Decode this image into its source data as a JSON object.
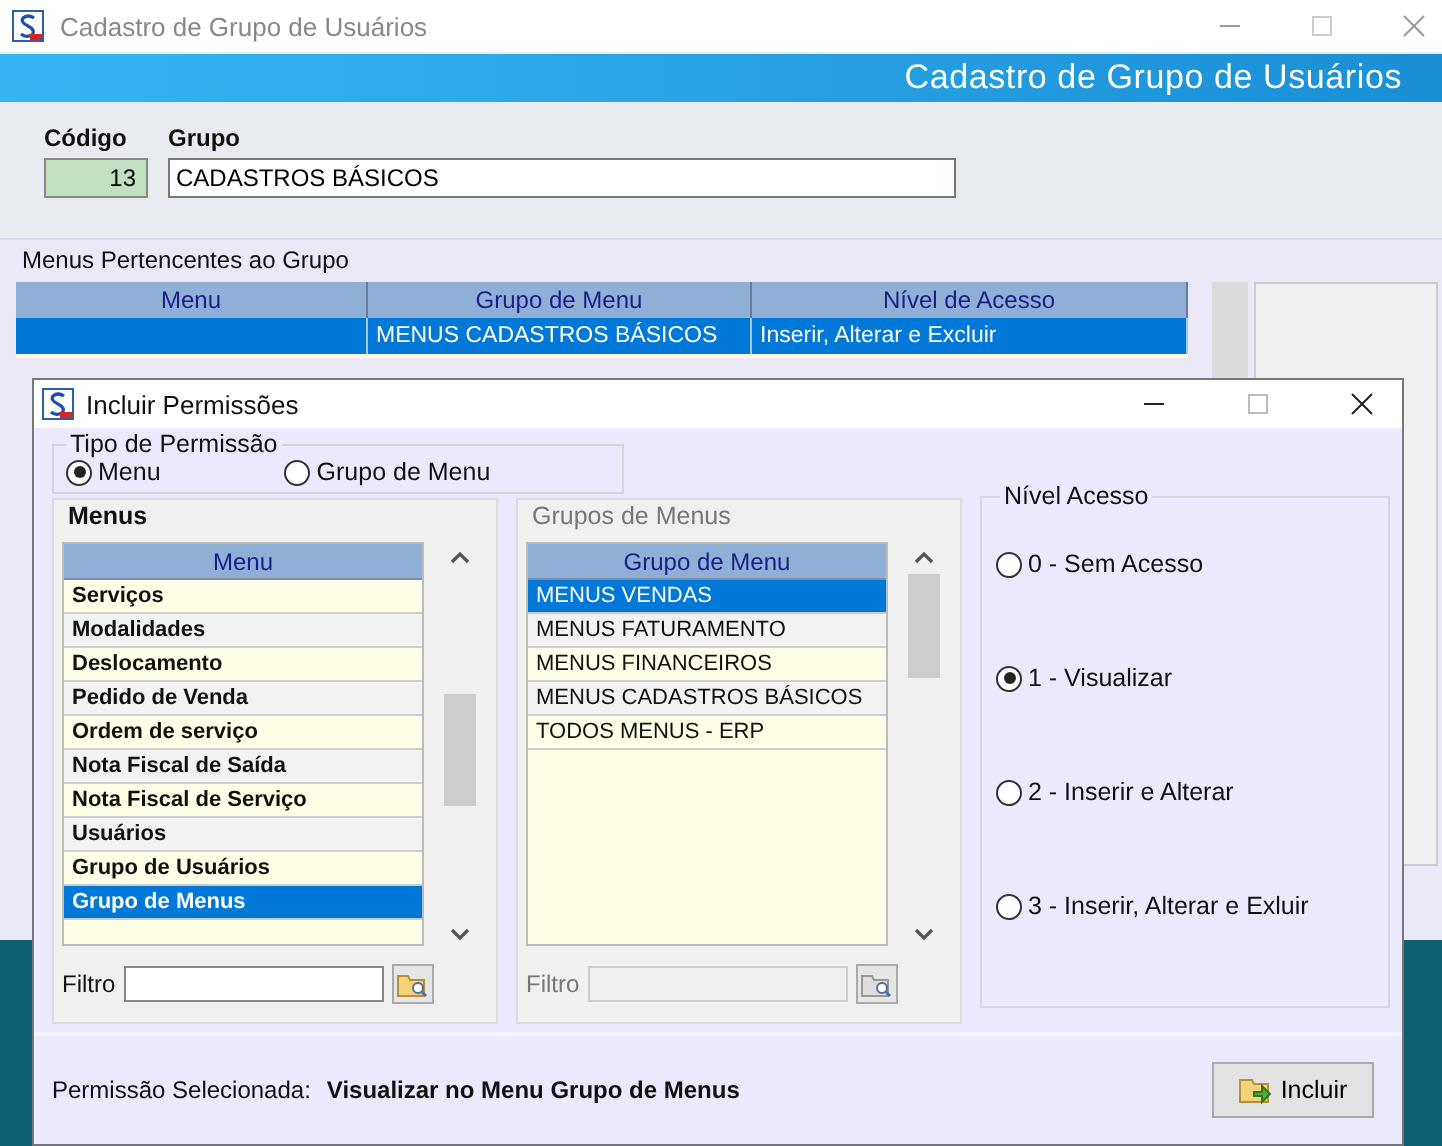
{
  "window": {
    "title": "Cadastro de Grupo de Usuários",
    "header": "Cadastro de Grupo de Usuários"
  },
  "fields": {
    "code_label": "Código",
    "code": "13",
    "group_label": "Grupo",
    "group": "CADASTROS BÁSICOS"
  },
  "members": {
    "title": "Menus Pertencentes ao Grupo",
    "columns": [
      "Menu",
      "Grupo de Menu",
      "Nível de Acesso"
    ],
    "rows": [
      {
        "group": "MENUS CADASTROS BÁSICOS",
        "access": "Inserir, Alterar e Excluir",
        "selected": true
      }
    ]
  },
  "dialog": {
    "title": "Incluir Permissões",
    "permission_type": {
      "title": "Tipo de Permissão",
      "options": [
        {
          "label": "Menu",
          "selected": true
        },
        {
          "label": "Grupo de Menu",
          "selected": false
        }
      ]
    },
    "lists": [
      {
        "title": "Menus",
        "column": "Menu",
        "disabled": false,
        "filter_label": "Filtro",
        "items": [
          {
            "label": "Serviços",
            "selected": false
          },
          {
            "label": "Modalidades",
            "selected": false
          },
          {
            "label": "Deslocamento",
            "selected": false
          },
          {
            "label": "Pedido de Venda",
            "selected": false
          },
          {
            "label": "Ordem de serviço",
            "selected": false
          },
          {
            "label": "Nota Fiscal de Saída",
            "selected": false
          },
          {
            "label": "Nota Fiscal de Serviço",
            "selected": false
          },
          {
            "label": "Usuários",
            "selected": false
          },
          {
            "label": "Grupo de Usuários",
            "selected": false
          },
          {
            "label": "Grupo de Menus",
            "selected": true
          }
        ]
      },
      {
        "title": "Grupos de Menus",
        "column": "Grupo de Menu",
        "disabled": true,
        "filter_label": "Filtro",
        "items": [
          {
            "label": "MENUS VENDAS",
            "selected": true
          },
          {
            "label": "MENUS FATURAMENTO",
            "selected": false
          },
          {
            "label": "MENUS FINANCEIROS",
            "selected": false
          },
          {
            "label": "MENUS CADASTROS BÁSICOS",
            "selected": false
          },
          {
            "label": "TODOS MENUS - ERP",
            "selected": false
          }
        ]
      }
    ],
    "access": {
      "title": "Nível Acesso",
      "options": [
        {
          "label": "0 - Sem Acesso",
          "selected": false
        },
        {
          "label": "1 - Visualizar",
          "selected": true
        },
        {
          "label": "2 - Inserir e Alterar",
          "selected": false
        },
        {
          "label": "3 - Inserir, Alterar e Exluir",
          "selected": false
        }
      ]
    },
    "status_label": "Permissão Selecionada:",
    "status_value": "Visualizar no Menu Grupo de Menus",
    "button": "Incluir"
  }
}
